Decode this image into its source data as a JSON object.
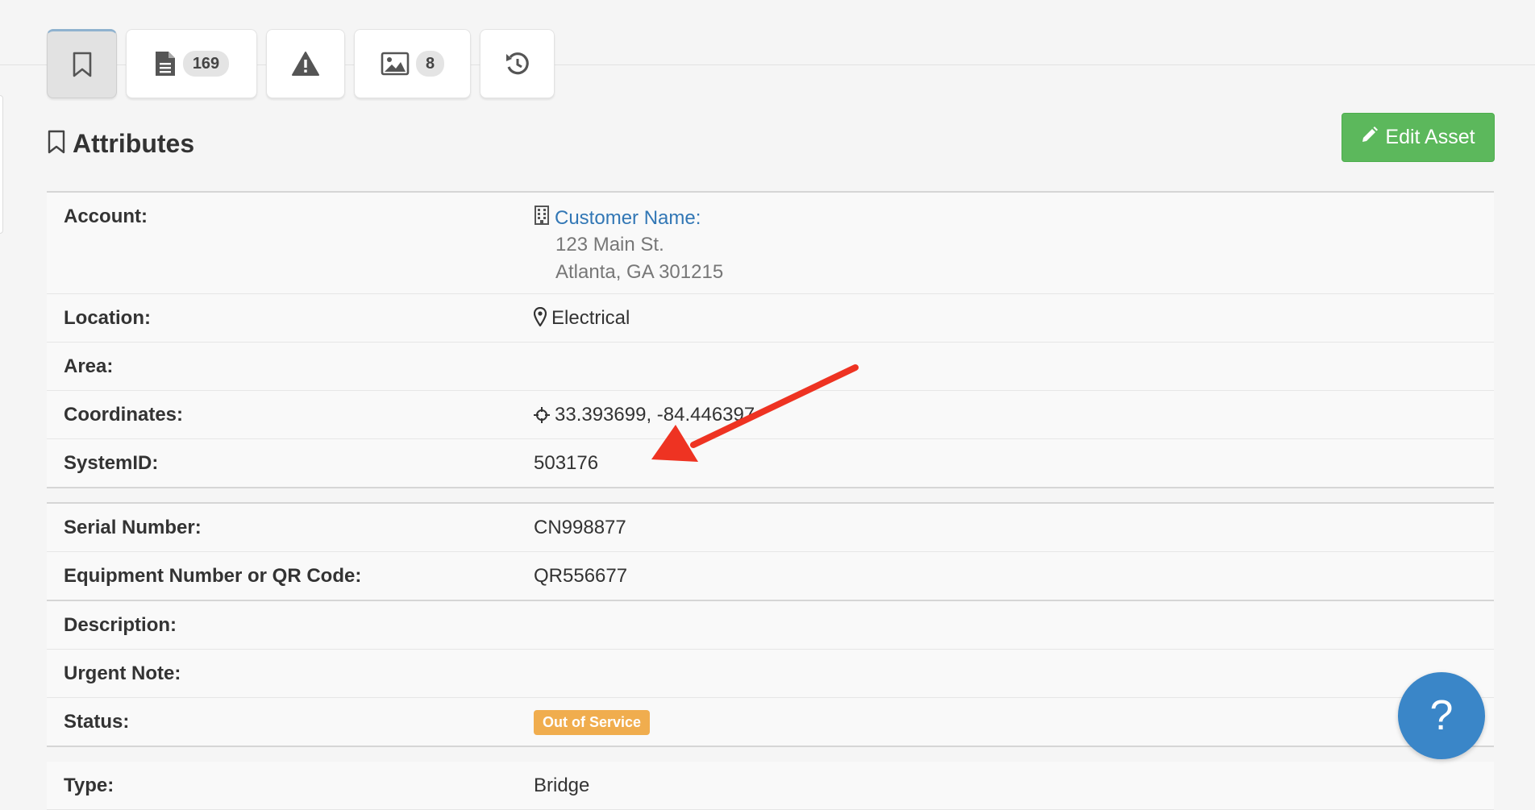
{
  "tabs": [
    {
      "name": "attributes",
      "icon": "bookmark-icon",
      "count": ""
    },
    {
      "name": "documents",
      "icon": "document-icon",
      "count": "169"
    },
    {
      "name": "alerts",
      "icon": "warning-icon",
      "count": ""
    },
    {
      "name": "images",
      "icon": "image-icon",
      "count": "8"
    },
    {
      "name": "history",
      "icon": "history-icon",
      "count": ""
    }
  ],
  "section": {
    "title": "Attributes",
    "icon": "bookmark-icon"
  },
  "edit_button": {
    "label": "Edit Asset",
    "icon": "pencil-icon",
    "color": "#5cb85c"
  },
  "attributes": {
    "account": {
      "label": "Account:",
      "name": "Customer Name:",
      "address1": "123 Main St.",
      "address2": "Atlanta, GA 301215",
      "icon": "building-icon"
    },
    "location": {
      "label": "Location:",
      "value": "Electrical",
      "icon": "map-marker-icon"
    },
    "area": {
      "label": "Area:",
      "value": ""
    },
    "coordinates": {
      "label": "Coordinates:",
      "value": "33.393699, -84.446397",
      "icon": "crosshairs-icon"
    },
    "system_id": {
      "label": "SystemID:",
      "value": "503176"
    },
    "serial_number": {
      "label": "Serial Number:",
      "value": "CN998877"
    },
    "equipment_number": {
      "label": "Equipment Number or QR Code:",
      "value": "QR556677"
    },
    "description": {
      "label": "Description:",
      "value": ""
    },
    "urgent_note": {
      "label": "Urgent Note:",
      "value": ""
    },
    "status": {
      "label": "Status:",
      "value": "Out of Service",
      "color": "#f0ad4e"
    },
    "type": {
      "label": "Type:",
      "value": "Bridge"
    }
  },
  "help_button": {
    "label": "?",
    "color": "#3a86c8"
  },
  "annotation": {
    "color": "#ee3322"
  }
}
